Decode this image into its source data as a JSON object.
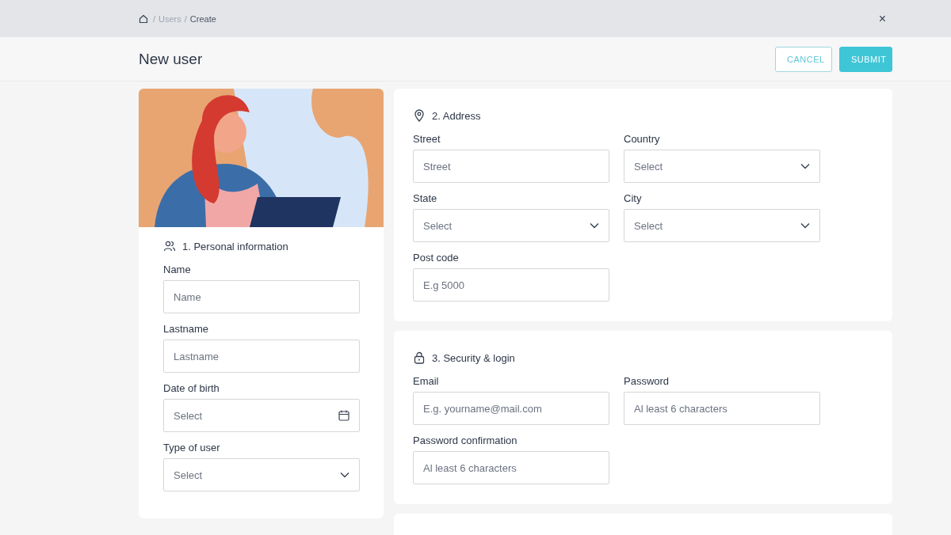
{
  "breadcrumb": [
    {
      "separator": "/",
      "label": "Users",
      "current": false
    },
    {
      "separator": "/",
      "label": "Create",
      "current": true
    }
  ],
  "close": "×",
  "page": {
    "title": "New user",
    "buttons": [
      {
        "label": "CANCEL",
        "kind": "outline"
      },
      {
        "label": "SUBMIT",
        "kind": "primary"
      }
    ]
  },
  "sections": [
    {
      "title": "1. Personal information",
      "fields": [
        {
          "label": "Name",
          "kind": "text",
          "placeholder": "Name"
        },
        {
          "label": "Lastname",
          "kind": "text",
          "placeholder": "Lastname"
        },
        {
          "label": "Date of birth",
          "kind": "date",
          "placeholder": "Select"
        },
        {
          "label": "Type of user",
          "kind": "select",
          "placeholder": "Select"
        }
      ]
    },
    {
      "title": "2. Address",
      "fields": [
        {
          "label": "Street",
          "kind": "text",
          "placeholder": "Street"
        },
        {
          "label": "Country",
          "kind": "select",
          "placeholder": "Select"
        },
        {
          "label": "State",
          "kind": "select",
          "placeholder": "Select"
        },
        {
          "label": "City",
          "kind": "select",
          "placeholder": "Select"
        },
        {
          "label": "Post code",
          "kind": "text",
          "placeholder": "E.g 5000"
        }
      ]
    },
    {
      "title": "3. Security & login",
      "fields": [
        {
          "label": "Email",
          "kind": "text",
          "placeholder": "E.g. yourname@mail.com"
        },
        {
          "label": "Password",
          "kind": "text",
          "placeholder": "Al least 6 characters"
        },
        {
          "label": "Password confirmation",
          "kind": "text",
          "placeholder": "Al least 6 characters"
        }
      ]
    }
  ]
}
